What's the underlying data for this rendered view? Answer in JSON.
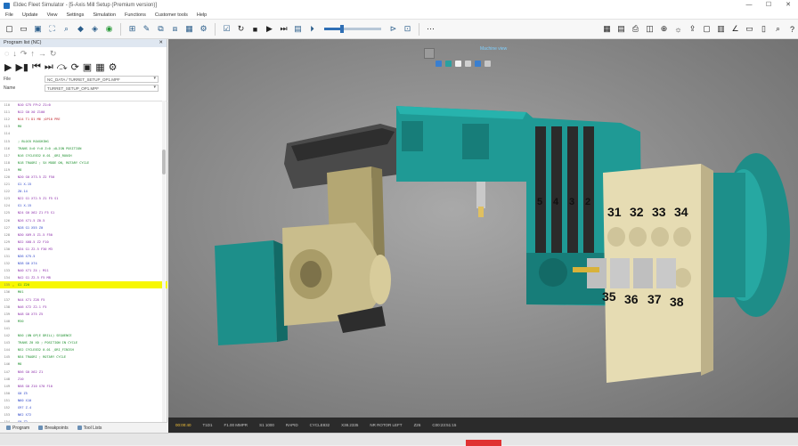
{
  "window": {
    "title": "Eldec Fleet Simulator - [5-Axis Mill Setup (Premium version)]",
    "controls": [
      "—",
      "☐",
      "✕"
    ]
  },
  "menu": [
    "File",
    "Update",
    "View",
    "Settings",
    "Simulation",
    "Functions",
    "Customer tools",
    "Help"
  ],
  "toolbar": {
    "speed_fraction": 0.32
  },
  "panel": {
    "title": "Program list (NC)",
    "close": "✕",
    "file_label": "File",
    "file_value": "NC_DATA / TURRET_SETUP_OP1.MPF",
    "name_label": "Name",
    "name_value": "TURRET_SETUP_OP1.MPF",
    "tabs": [
      "Program",
      "Breakpoints",
      "Tool Lists"
    ]
  },
  "code_lines": [
    {
      "n": "110",
      "t": "N10 G75 FP=2 Z1=0",
      "c": "c-purple",
      "hl": false
    },
    {
      "n": "111",
      "t": "N12 G0 X0 Z100",
      "c": "c-purple",
      "hl": false
    },
    {
      "n": "112",
      "t": "N14 T1 D1 M6 ;OP10 PRE",
      "c": "c-red",
      "hl": false
    },
    {
      "n": "113",
      "t": "M0",
      "c": "c-green",
      "hl": false
    },
    {
      "n": "114",
      "t": "",
      "c": "",
      "hl": false
    },
    {
      "n": "115",
      "t": "; BLOCK ROUGHING",
      "c": "c-green",
      "hl": false
    },
    {
      "n": "116",
      "t": "TRANS X=0 Y=0 Z=0 ;ALIGN POSITION",
      "c": "c-green",
      "hl": false
    },
    {
      "n": "117",
      "t": "N16 CYCLE832 0.01 _ORI_ROUGH",
      "c": "c-green",
      "hl": false
    },
    {
      "n": "118",
      "t": "N18 TRAORI ; 5X MODE ON, ROTARY CYCLE",
      "c": "c-green",
      "hl": false
    },
    {
      "n": "119",
      "t": "M8",
      "c": "c-green",
      "hl": false
    },
    {
      "n": "120",
      "t": "N20 G0 X73.5 Z2 F50",
      "c": "c-purple",
      "hl": false
    },
    {
      "n": "121",
      "t": "G1 X-15",
      "c": "c-blue",
      "hl": false
    },
    {
      "n": "122",
      "t": "Z0.14",
      "c": "c-blue",
      "hl": false
    },
    {
      "n": "123",
      "t": "N22 G1 X72.5 Z1 F5 S1",
      "c": "c-purple",
      "hl": false
    },
    {
      "n": "124",
      "t": "G1 X-15",
      "c": "c-blue",
      "hl": false
    },
    {
      "n": "125",
      "t": "N24 G0 X62 Z1 F5 S1",
      "c": "c-purple",
      "hl": false
    },
    {
      "n": "126",
      "t": "N26 X71.5 Z0.5",
      "c": "c-purple",
      "hl": false
    },
    {
      "n": "127",
      "t": "N28 G1 X55 Z0",
      "c": "c-blue",
      "hl": false
    },
    {
      "n": "128",
      "t": "N30 X69.5 Z1.5 F50",
      "c": "c-purple",
      "hl": false
    },
    {
      "n": "129",
      "t": "N32 X68.5 Z2 F10",
      "c": "c-purple",
      "hl": false
    },
    {
      "n": "130",
      "t": "N34 G1 Z2.5 F30 M3",
      "c": "c-purple",
      "hl": false
    },
    {
      "n": "131",
      "t": "N36 X75.5",
      "c": "c-blue",
      "hl": false
    },
    {
      "n": "132",
      "t": "N38 G0 X74",
      "c": "c-blue",
      "hl": false
    },
    {
      "n": "133",
      "t": "N40 X71 Z4 ; M11",
      "c": "c-purple",
      "hl": false
    },
    {
      "n": "134",
      "t": "N42 G1 Z2.5 F5 M8",
      "c": "c-purple",
      "hl": false
    },
    {
      "n": "135",
      "t": "G1 Z20",
      "c": "c-green",
      "hl": true
    },
    {
      "n": "136",
      "t": "M01",
      "c": "c-green",
      "hl": false
    },
    {
      "n": "137",
      "t": "N44 X71 Z28 F5",
      "c": "c-purple",
      "hl": false
    },
    {
      "n": "138",
      "t": "N46 X72 Z2.1 F5",
      "c": "c-purple",
      "hl": false
    },
    {
      "n": "139",
      "t": "N48 G0 X75 Z5",
      "c": "c-purple",
      "hl": false
    },
    {
      "n": "140",
      "t": "M30",
      "c": "c-green",
      "hl": false
    },
    {
      "n": "141",
      "t": "",
      "c": "",
      "hl": false
    },
    {
      "n": "142",
      "t": "N50 (ON OP)E DRILL) SEQUENCE",
      "c": "c-green",
      "hl": false
    },
    {
      "n": "143",
      "t": "TRANS Z0 X0 ; POSITION IN CYCLE",
      "c": "c-green",
      "hl": false
    },
    {
      "n": "144",
      "t": "N52 CYCLE832 0.01 _ORI_FINISH",
      "c": "c-green",
      "hl": false
    },
    {
      "n": "145",
      "t": "N54 TRAORI ; ROTARY CYCLE",
      "c": "c-green",
      "hl": false
    },
    {
      "n": "146",
      "t": "M8",
      "c": "c-green",
      "hl": false
    },
    {
      "n": "147",
      "t": "N56 G0 X62 Z1",
      "c": "c-purple",
      "hl": false
    },
    {
      "n": "148",
      "t": "Z10",
      "c": "c-purple",
      "hl": false
    },
    {
      "n": "149",
      "t": "N58 G0 Z10 X70 F10",
      "c": "c-purple",
      "hl": false
    },
    {
      "n": "150",
      "t": "G0 Z5",
      "c": "c-blue",
      "hl": false
    },
    {
      "n": "151",
      "t": "N60 X10",
      "c": "c-blue",
      "hl": false
    },
    {
      "n": "152",
      "t": "G97 Z-4",
      "c": "c-blue",
      "hl": false
    },
    {
      "n": "153",
      "t": "N62 X72",
      "c": "c-blue",
      "hl": false
    },
    {
      "n": "154",
      "t": "G0 Z2",
      "c": "c-blue",
      "hl": false
    },
    {
      "n": "155",
      "t": "N64 X75",
      "c": "c-blue",
      "hl": false
    },
    {
      "n": "156",
      "t": "M30",
      "c": "c-green",
      "hl": false
    },
    {
      "n": "157",
      "t": "",
      "c": "",
      "hl": false
    },
    {
      "n": "158",
      "t": "; ENDSTATE REMARKS",
      "c": "c-green",
      "hl": false
    }
  ],
  "viewport": {
    "label": "Machine view",
    "turret_numbers_top": [
      "31",
      "32",
      "33",
      "34"
    ],
    "turret_numbers_bottom": [
      "35",
      "36",
      "37",
      "38"
    ],
    "tool_numbers": [
      "5",
      "4",
      "3",
      "2"
    ]
  },
  "status": [
    {
      "t": "00:00:40",
      "cls": "warn"
    },
    {
      "t": "T1D1",
      "cls": ""
    },
    {
      "t": "F1.00 MMPR",
      "cls": ""
    },
    {
      "t": "S1 1000",
      "cls": ""
    },
    {
      "t": "RAPID",
      "cls": ""
    },
    {
      "t": "CYCLE832",
      "cls": ""
    },
    {
      "t": "X38.2335",
      "cls": ""
    },
    {
      "t": "NR ROTOR LEFT",
      "cls": ""
    },
    {
      "t": "Z26",
      "cls": ""
    },
    {
      "t": "C00:23:51:15",
      "cls": ""
    }
  ],
  "colors": {
    "accent": "#2f6fb5",
    "highlight": "#f7f700",
    "teal": "#1f9a95",
    "brass": "#c9bd8c"
  }
}
